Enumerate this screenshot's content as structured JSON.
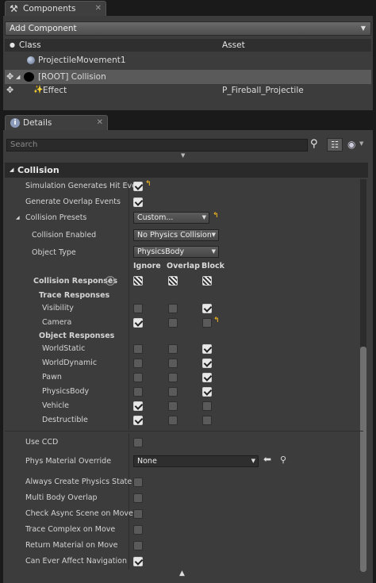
{
  "components_panel": {
    "tab_label": "Components",
    "add_component_label": "Add Component",
    "columns": {
      "class": "Class",
      "asset": "Asset"
    },
    "tree": [
      {
        "name": "ProjectileMovement1",
        "asset": ""
      },
      {
        "name": "[ROOT] Collision",
        "asset": ""
      },
      {
        "name": "Effect",
        "asset": "P_Fireball_Projectile"
      }
    ]
  },
  "details_panel": {
    "tab_label": "Details",
    "search_placeholder": "Search",
    "category": "Collision",
    "props": {
      "sim_hit": "Simulation Generates Hit Ever",
      "overlap": "Generate Overlap Events",
      "presets": "Collision Presets",
      "presets_value": "Custom...",
      "enabled": "Collision Enabled",
      "enabled_value": "No Physics Collision",
      "object_type": "Object Type",
      "object_type_value": "PhysicsBody"
    },
    "response_columns": {
      "ignore": "Ignore",
      "overlap": "Overlap",
      "block": "Block"
    },
    "responses_label": "Collision Responses",
    "trace_header": "Trace Responses",
    "trace_rows": [
      {
        "label": "Visibility",
        "state": [
          false,
          false,
          true
        ]
      },
      {
        "label": "Camera",
        "state": [
          true,
          false,
          false
        ]
      }
    ],
    "object_header": "Object Responses",
    "object_rows": [
      {
        "label": "WorldStatic",
        "state": [
          false,
          false,
          true
        ]
      },
      {
        "label": "WorldDynamic",
        "state": [
          false,
          false,
          true
        ]
      },
      {
        "label": "Pawn",
        "state": [
          false,
          false,
          true
        ]
      },
      {
        "label": "PhysicsBody",
        "state": [
          false,
          false,
          true
        ]
      },
      {
        "label": "Vehicle",
        "state": [
          true,
          false,
          false
        ]
      },
      {
        "label": "Destructible",
        "state": [
          true,
          false,
          false
        ]
      }
    ],
    "lower_props": [
      {
        "label": "Use CCD",
        "checked": false
      },
      {
        "label": "Phys Material Override",
        "value": "None"
      },
      {
        "label": "Always Create Physics State",
        "checked": false
      },
      {
        "label": "Multi Body Overlap",
        "checked": false
      },
      {
        "label": "Check Async Scene on Move",
        "checked": false
      },
      {
        "label": "Trace Complex on Move",
        "checked": false
      },
      {
        "label": "Return Material on Move",
        "checked": false
      },
      {
        "label": "Can Ever Affect Navigation",
        "checked": true
      }
    ]
  },
  "colors": {
    "panel": "#3c3c3c",
    "row_highlight": "#5a5a5a",
    "reset_arrow": "#e8b020"
  }
}
